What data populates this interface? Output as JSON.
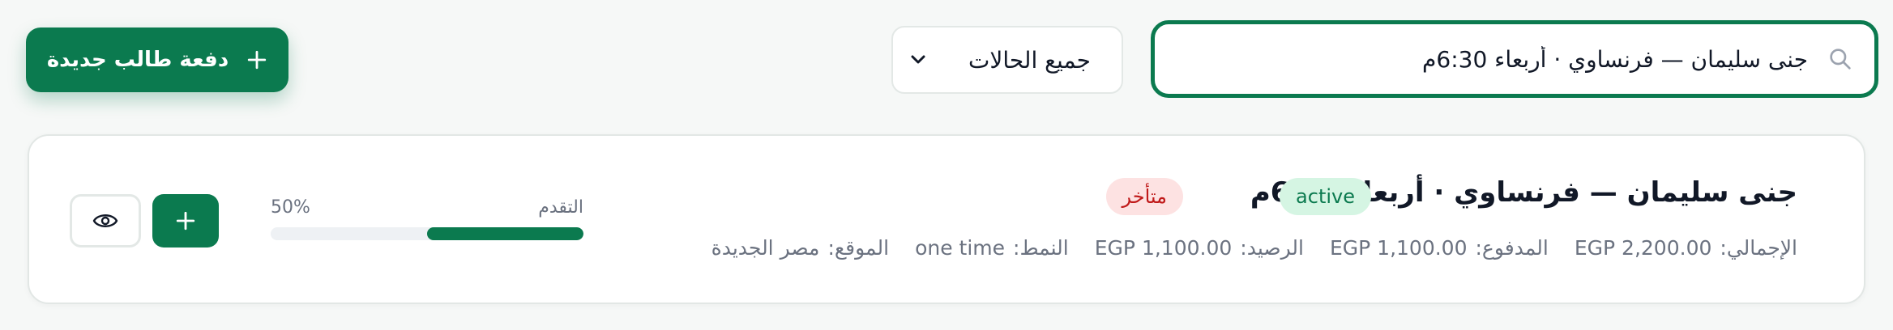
{
  "search": {
    "value": "جنى سليمان — فرنساوي · أربعاء 6:30م",
    "icon": "search-icon"
  },
  "status_filter": {
    "selected": "جميع الحالات"
  },
  "toolbar": {
    "new_batch_label": "دفعة طالب جديدة"
  },
  "batch": {
    "title": "جنى سليمان — فرنساوي · أربعاء 6:30م",
    "status_badge": "active",
    "late_badge": "متأخر",
    "meta": [
      {
        "label": "الإجمالي:",
        "value": "EGP 2,200.00"
      },
      {
        "label": "المدفوع:",
        "value": "EGP 1,100.00"
      },
      {
        "label": "الرصيد:",
        "value": "EGP 1,100.00"
      },
      {
        "label": "النمط:",
        "value": "one time"
      },
      {
        "label": "الموقع:",
        "value": "مصر الجديدة"
      }
    ],
    "progress": {
      "label": "التقدم",
      "percent_text": "50%",
      "fraction": 0.5
    }
  },
  "colors": {
    "accent": "#0b7a4f",
    "active_bg": "#d5f5e3",
    "late_bg": "#fde2e2",
    "late_text": "#c01919"
  }
}
